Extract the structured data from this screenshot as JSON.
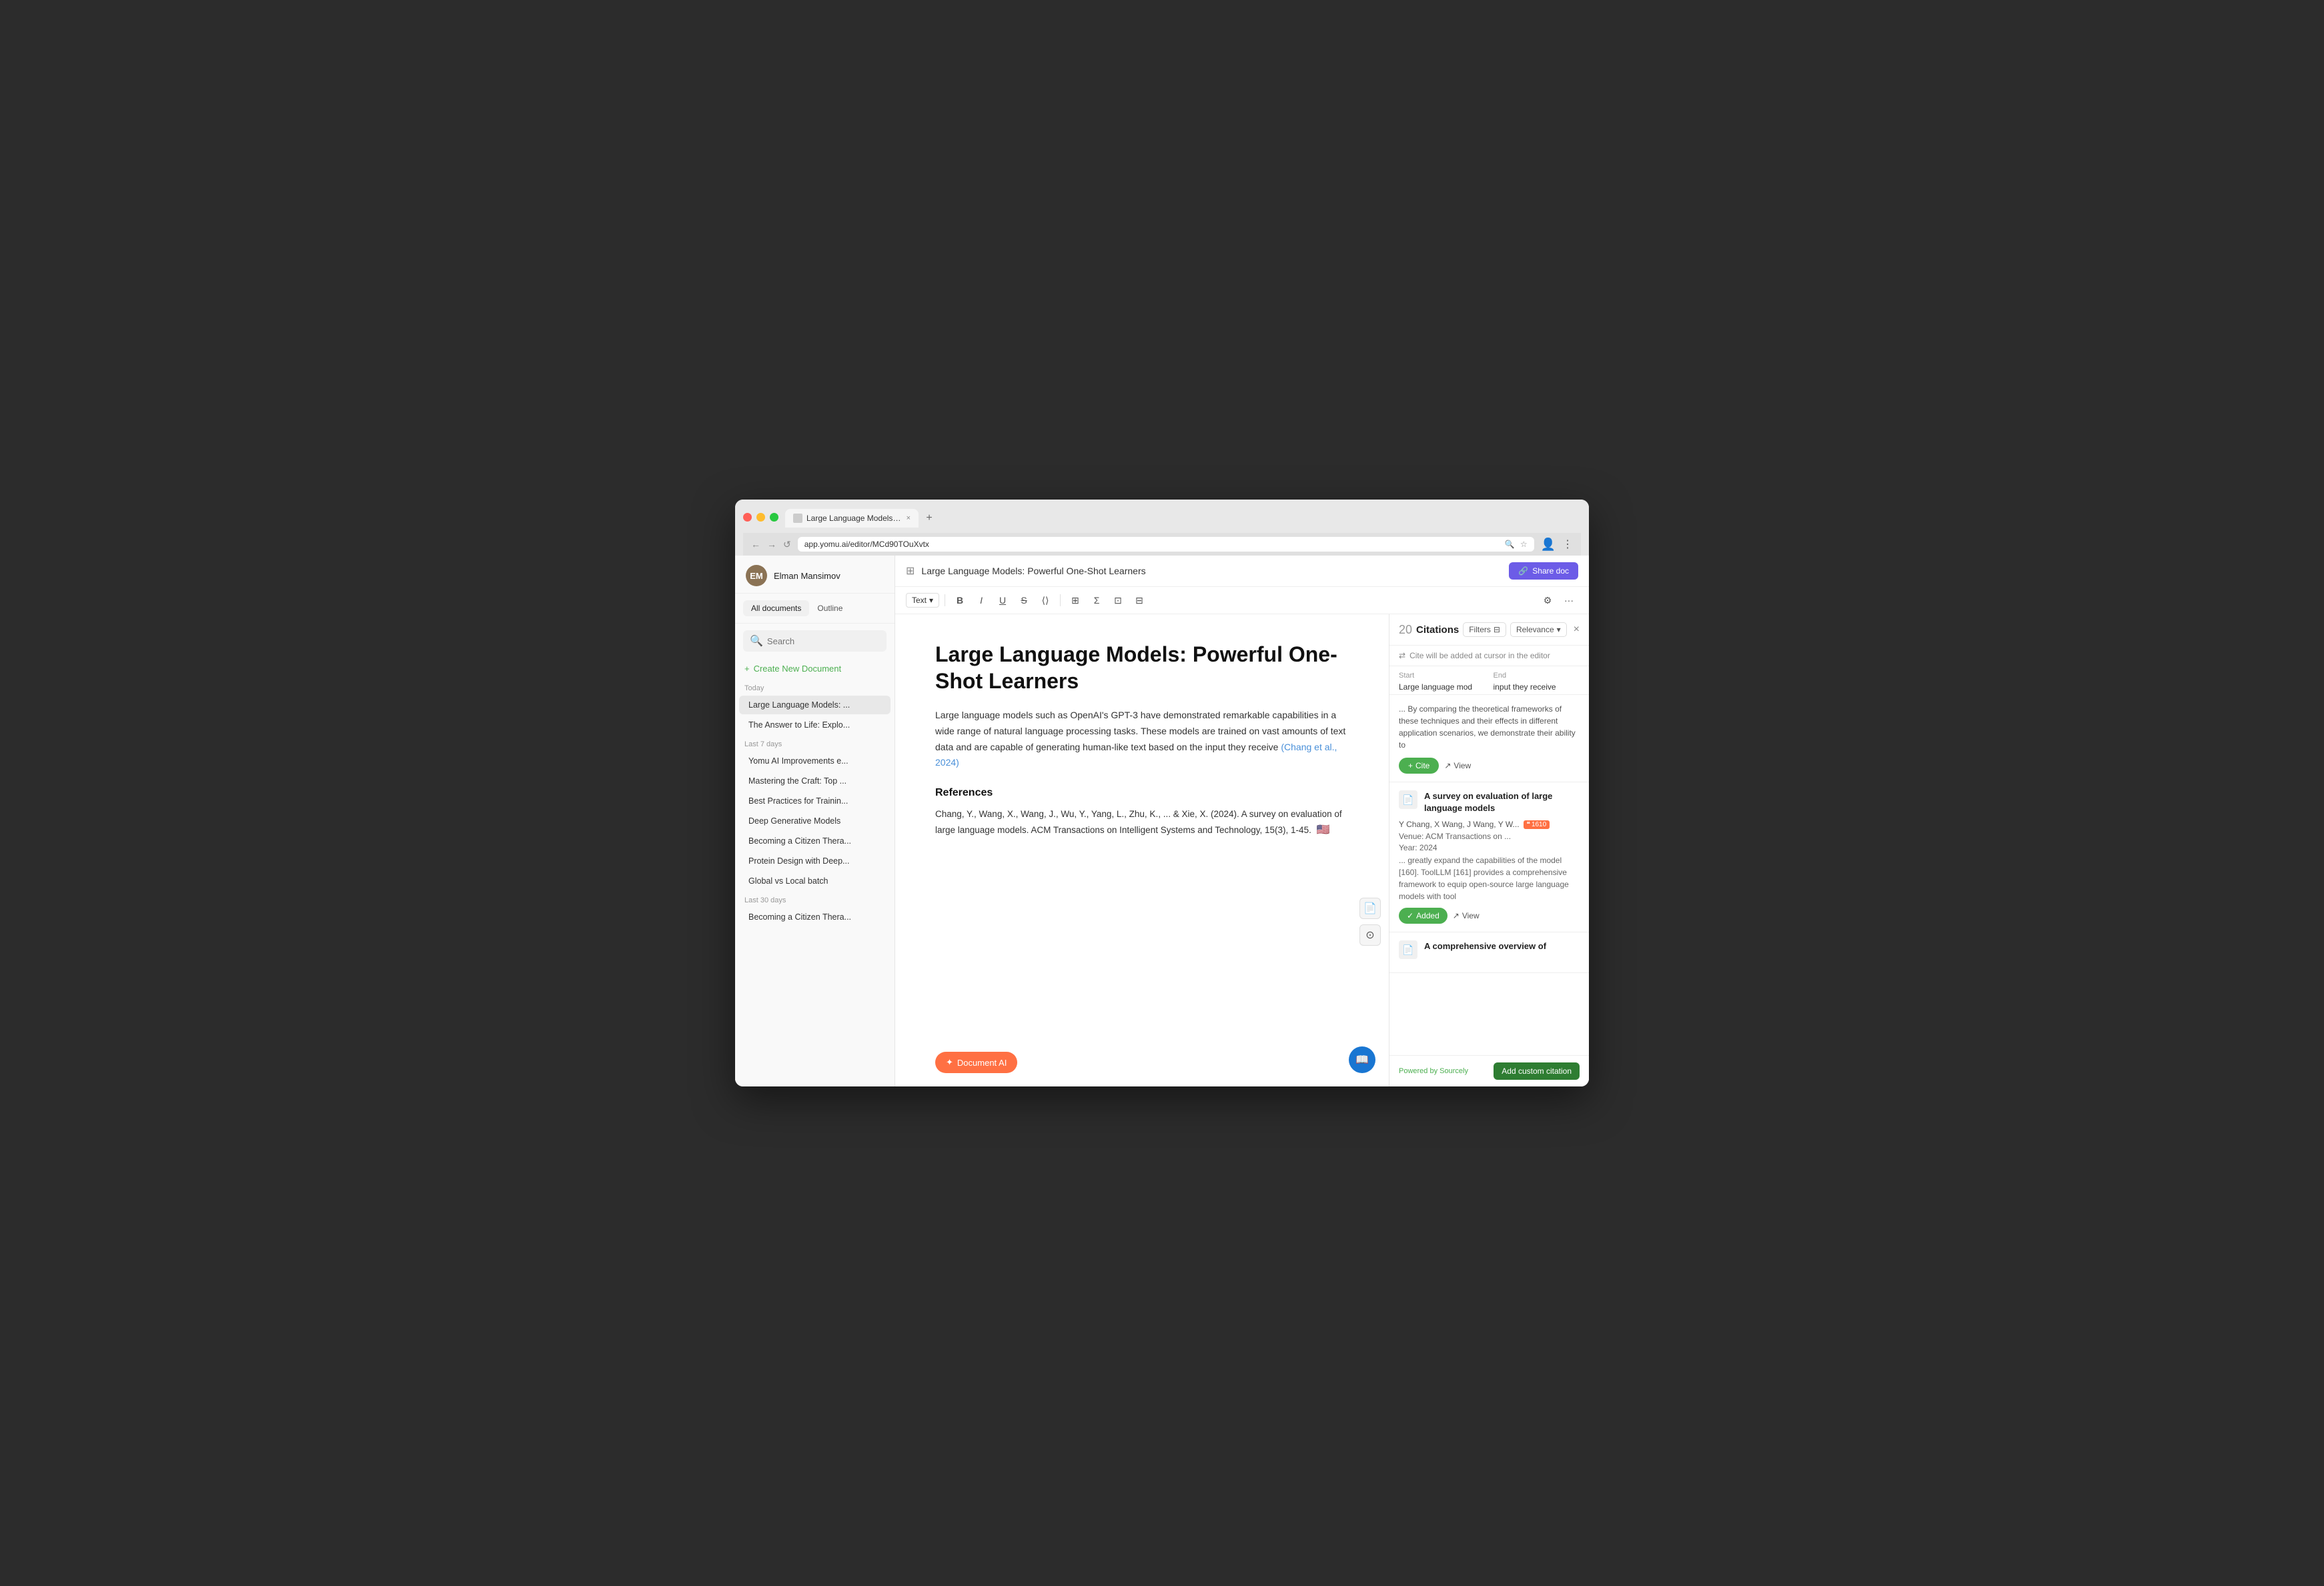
{
  "browser": {
    "url": "app.yomu.ai/editor/MCd90TOuXvtx",
    "tab_title": "Large Language Models: Pow...",
    "tab_close": "×",
    "tab_new": "+"
  },
  "header": {
    "panel_icon": "⊞",
    "doc_title": "Large Language Models: Powerful One-Shot Learners",
    "share_label": "Share doc"
  },
  "toolbar": {
    "text_format": "Text",
    "bold": "B",
    "italic": "I",
    "underline": "U",
    "strikethrough": "S",
    "link": "⟨⟩",
    "table": "⊞",
    "formula": "Σ",
    "image": "⊡",
    "copy": "⊟",
    "settings": "⚙",
    "more": "···"
  },
  "sidebar": {
    "user_name": "Elman Mansimov",
    "user_initials": "EM",
    "tabs": [
      {
        "label": "All documents",
        "active": true
      },
      {
        "label": "Outline",
        "active": false
      }
    ],
    "search_placeholder": "Search",
    "create_new_label": "Create New Document",
    "sections": [
      {
        "label": "Today",
        "items": [
          {
            "label": "Large Language Models: ...",
            "active": true
          },
          {
            "label": "The Answer to Life: Explo...",
            "active": false
          }
        ]
      },
      {
        "label": "Last 7 days",
        "items": [
          {
            "label": "Yomu AI Improvements e...",
            "active": false
          },
          {
            "label": "Mastering the Craft: Top ...",
            "active": false
          },
          {
            "label": "Best Practices for Trainin...",
            "active": false
          },
          {
            "label": "Deep Generative Models",
            "active": false
          },
          {
            "label": "Becoming a Citizen Thera...",
            "active": false
          },
          {
            "label": "Protein Design with Deep...",
            "active": false
          },
          {
            "label": "Global vs Local batch",
            "active": false
          }
        ]
      },
      {
        "label": "Last 30 days",
        "items": [
          {
            "label": "Becoming a Citizen Thera...",
            "active": false
          }
        ]
      }
    ]
  },
  "editor": {
    "heading": "Large Language Models: Powerful One-Shot Learners",
    "body": "Large language models such as OpenAI's GPT-3 have demonstrated remarkable capabilities in a wide range of natural language processing tasks. These models are trained on vast amounts of text data and are capable of generating human-like text based on the input they receive",
    "citation_link": "(Chang et al., 2024)",
    "references_heading": "References",
    "reference_item": "Chang, Y., Wang, X., Wang, J., Wu, Y., Yang, L., Zhu, K., ... & Xie, X. (2024). A survey on evaluation of large language models. ACM Transactions on Intelligent Systems and Technology, 15(3), 1-45.",
    "flag": "🇺🇸",
    "doc_ai_label": "Document AI",
    "book_icon": "📖"
  },
  "citations_panel": {
    "count": "20",
    "title": "Citations",
    "filters_label": "Filters",
    "relevance_label": "Relevance",
    "close_icon": "×",
    "cursor_info": "Cite will be added at cursor in the editor",
    "start_label": "Start",
    "end_label": "End",
    "start_value": "Large language mod",
    "end_value": "input they receive",
    "preview_text": "... By comparing the theoretical frameworks of these techniques and their effects in different application scenarios, we demonstrate their ability to",
    "cite_label": "Cite",
    "view_label": "View",
    "card1": {
      "title": "A survey on evaluation of large language models",
      "authors": "Y Chang, X Wang, J Wang, Y W...",
      "citation_count": "1610",
      "venue": "Venue: ACM Transactions on ...",
      "year": "Year: 2024",
      "excerpt": "... greatly expand the capabilities of the model [160]. ToolLLM [161] provides a comprehensive framework to equip open-source large language models with tool",
      "added_label": "Added",
      "view_label": "View"
    },
    "card2": {
      "title": "A comprehensive overview of"
    },
    "footer": {
      "powered_by": "Powered by",
      "source": "Sourcely",
      "add_citation_label": "Add custom citation"
    }
  }
}
